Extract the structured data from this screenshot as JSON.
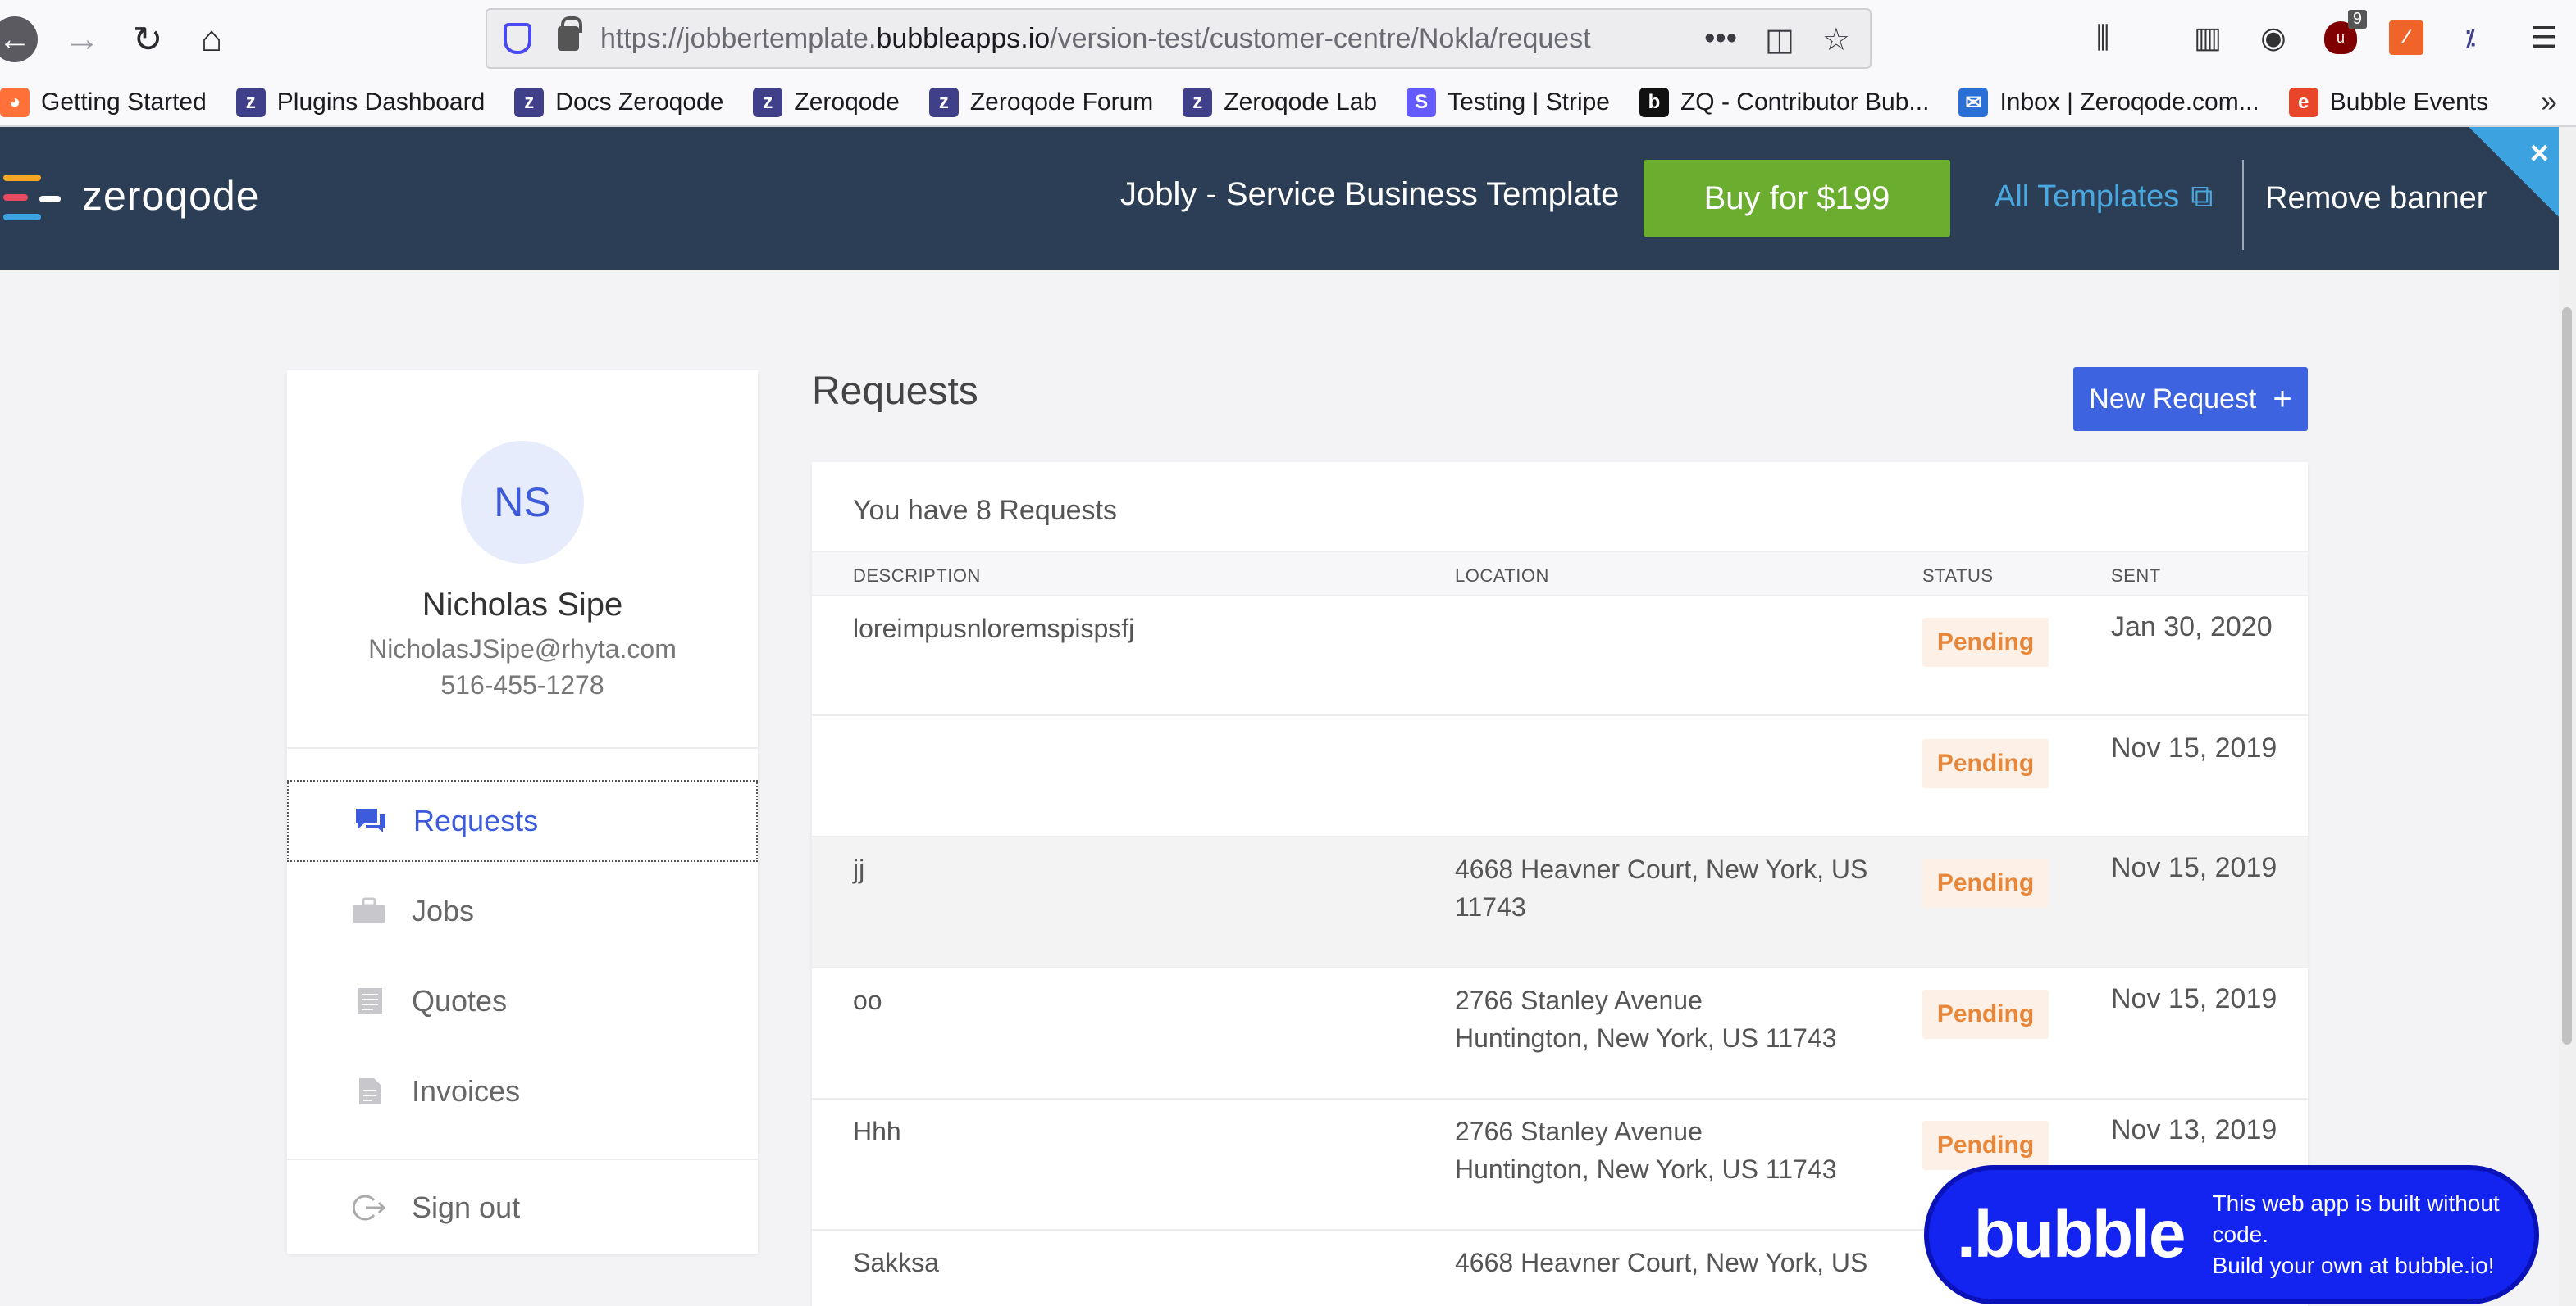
{
  "browser": {
    "url_prefix": "https://jobbertemplate.",
    "url_domain": "bubbleapps.io",
    "url_path": "/version-test/customer-centre/Nokla/request",
    "extension_badge": "9",
    "bookmarks": [
      {
        "label": "Getting Started",
        "icon": "firefox-icon",
        "color": "#ff7139"
      },
      {
        "label": "Plugins Dashboard",
        "icon": "zeroqode-icon",
        "color": "#3f3f8a"
      },
      {
        "label": "Docs Zeroqode",
        "icon": "zeroqode-icon",
        "color": "#3f3f8a"
      },
      {
        "label": "Zeroqode",
        "icon": "zeroqode-icon",
        "color": "#3f3f8a"
      },
      {
        "label": "Zeroqode Forum",
        "icon": "zeroqode-icon",
        "color": "#3f3f8a"
      },
      {
        "label": "Zeroqode Lab",
        "icon": "zeroqode-icon",
        "color": "#3f3f8a"
      },
      {
        "label": "Testing | Stripe",
        "icon": "stripe-icon",
        "color": "#635bff"
      },
      {
        "label": "ZQ - Contributor Bub...",
        "icon": "bubble-b-icon",
        "color": "#111111"
      },
      {
        "label": "Inbox | Zeroqode.com...",
        "icon": "mail-icon",
        "color": "#2a6fd6"
      },
      {
        "label": "Bubble Events",
        "icon": "events-icon",
        "color": "#e8452a"
      }
    ]
  },
  "banner": {
    "logo_text": "zeroqode",
    "template_title": "Jobly - Service Business Template",
    "buy_label": "Buy for $199",
    "all_templates_label": "All Templates",
    "remove_label": "Remove banner",
    "close_glyph": "×"
  },
  "profile": {
    "initials": "NS",
    "name": "Nicholas Sipe",
    "email": "NicholasJSipe@rhyta.com",
    "phone": "516-455-1278"
  },
  "sidebar": {
    "items": [
      {
        "label": "Requests",
        "icon": "chat-icon"
      },
      {
        "label": "Jobs",
        "icon": "briefcase-icon"
      },
      {
        "label": "Quotes",
        "icon": "quote-doc-icon"
      },
      {
        "label": "Invoices",
        "icon": "invoice-doc-icon"
      }
    ],
    "sign_out": "Sign out"
  },
  "main": {
    "title": "Requests",
    "new_request_label": "New Request",
    "count_text": "You have 8 Requests",
    "columns": [
      "DESCRIPTION",
      "LOCATION",
      "STATUS",
      "SENT"
    ],
    "rows": [
      {
        "description": "loreimpusnloremspispsfj",
        "location_1": "",
        "location_2": "",
        "status": "Pending",
        "sent": "Jan 30, 2020"
      },
      {
        "description": "",
        "location_1": "",
        "location_2": "",
        "status": "Pending",
        "sent": "Nov 15, 2019"
      },
      {
        "description": "jj",
        "location_1": "4668 Heavner Court, New York, US",
        "location_2": "11743",
        "status": "Pending",
        "sent": "Nov 15, 2019"
      },
      {
        "description": "oo",
        "location_1": "2766 Stanley Avenue",
        "location_2": "Huntington, New York, US 11743",
        "status": "Pending",
        "sent": "Nov 15, 2019"
      },
      {
        "description": "Hhh",
        "location_1": "2766 Stanley Avenue",
        "location_2": "Huntington, New York, US 11743",
        "status": "Pending",
        "sent": "Nov 13, 2019"
      },
      {
        "description": "Sakksa",
        "location_1": "4668 Heavner Court, New York, US",
        "location_2": "",
        "status": "",
        "sent": ""
      }
    ]
  },
  "bubble_badge": {
    "logo": ".bubble",
    "line1": "This web app is built without code.",
    "line2": "Build your own at bubble.io!"
  },
  "colors": {
    "accent": "#3d63e0",
    "banner_bg": "#2c3e55",
    "buy_green": "#6aad2f",
    "pending_text": "#e8873a",
    "pending_bg": "#fdf0e6"
  }
}
